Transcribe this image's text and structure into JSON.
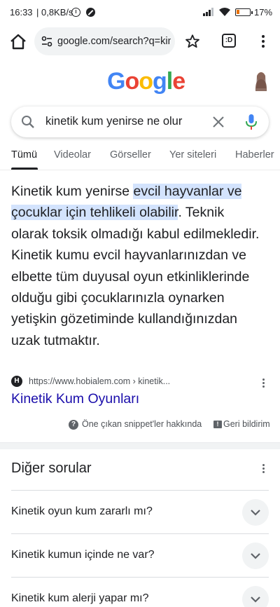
{
  "status_bar": {
    "time": "16:33",
    "network_speed": "| 0,8KB/s",
    "battery": "17%",
    "battery_color": "#e8710a"
  },
  "browser": {
    "url": "google.com/search?q=kinetik",
    "tab_count_label": ":D",
    "icons": [
      "home-icon",
      "site-settings-icon",
      "star-icon",
      "tab-switcher-icon",
      "more-vert-icon"
    ]
  },
  "google": {
    "logo": [
      "G",
      "o",
      "o",
      "g",
      "l",
      "e"
    ],
    "query": "kinetik kum yenirse ne olur"
  },
  "tabs": [
    {
      "label": "Tümü",
      "active": true
    },
    {
      "label": "Videolar"
    },
    {
      "label": "Görseller"
    },
    {
      "label": "Yer siteleri"
    },
    {
      "label": "Haberler"
    }
  ],
  "snippet": {
    "text_before": "Kinetik kum yenirse ",
    "highlight": "evcil hayvanlar ve çocuklar için tehlikeli olabilir",
    "text_after": ". Teknik olarak toksik olmadığı kabul edilmekledir. Kinetik kumu evcil hayvanlarınızdan ve elbette tüm duyusal oyun etkinliklerinde olduğu gibi çocuklarınızla oynarken yetişkin gözetiminde kullandığınızdan uzak tutmaktır.",
    "source_url": "https://www.hobialem.com › kinetik...",
    "source_title": "Kinetik Kum Oyunları",
    "about_label": "Öne çıkan snippet'ler hakkında",
    "feedback_label": "Geri bildirim",
    "highlight_color": "#d3e3fd",
    "link_color": "#1a0dab"
  },
  "other_questions": {
    "title": "Diğer sorular",
    "items": [
      "Kinetik oyun kum zararlı mı?",
      "Kinetik kumun içinde ne var?",
      "Kinetik kum alerji yapar mı?"
    ]
  }
}
